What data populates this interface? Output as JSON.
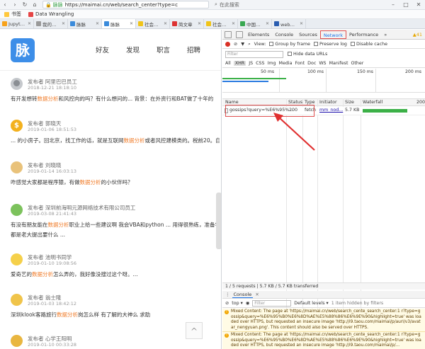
{
  "browser": {
    "site_name": "脉脉",
    "url": "https://maimai.cn/web/search_center?type=c",
    "search_placeholder": "在此搜索",
    "bookmarks": [
      "书签",
      "Data Wrangling"
    ],
    "tabs": [
      {
        "label": "Jupyter Lab",
        "active": false
      },
      {
        "label": "我的项目 - Kr",
        "active": false
      },
      {
        "label": "脉脉",
        "active": false
      },
      {
        "label": "脉脉",
        "active": true
      },
      {
        "label": "社会化聊天",
        "active": false
      },
      {
        "label": "简文章",
        "active": false
      },
      {
        "label": "社会化聊你",
        "active": false
      },
      {
        "label": "中国大学MO",
        "active": false
      },
      {
        "label": "web前端开",
        "active": false
      }
    ]
  },
  "page": {
    "logo_text": "脉",
    "nav": [
      "好友",
      "发现",
      "职言",
      "招聘"
    ],
    "posts": [
      {
        "author": "发布者 阿里巴巴员工",
        "time": "2018-12-21 18:18:10",
        "text_before": "有开发想转",
        "highlight": "数据分析",
        "text_after": "和风控向的吗？有什么想问的... 背景：在外资行和BAT做了十年的"
      },
      {
        "author": "发布者 郭晓天",
        "time": "2019-01-06 18:51:53",
        "text_before": "... 的小房子。回北京，找工作的话，就是互联网",
        "highlight": "数据分析",
        "text_after": "或者风控建模类的。税前20。自"
      },
      {
        "author": "发布者 刘晓晓",
        "time": "2019-01-14 16:03:13",
        "text_before": "咋感觉大家都是程序猿，有做",
        "highlight": "数据分析",
        "text_after": "的小伙伴吗？"
      },
      {
        "author": "发布者 深圳前海明元源网络技术有限公司员工",
        "time": "2019-03-08 21:41:43",
        "text_before": "有没有朋友能在",
        "highlight": "数据分析",
        "text_after": "职业上给一些建议啊 我会VBA和python ... 用得很熟练，准备学"
      },
      {
        "author": "",
        "time": "",
        "text_before": "都是老大提出要什么 ...",
        "highlight": "",
        "text_after": ""
      },
      {
        "author": "发布者 池明书同学",
        "time": "2019-01-10 19:08:56",
        "text_before": "爱奇艺的",
        "highlight": "数据分析",
        "text_after": "怎么弄的，我好像没搜过这个呀。..."
      },
      {
        "author": "发布者 翁士隆",
        "time": "2019-01-03 18:42:12",
        "text_before": "深圳klook客路旅行",
        "highlight": "数据分析",
        "text_after": "岗怎么样 有了解的大神么 求助"
      },
      {
        "author": "发布者 心学王阳明",
        "time": "2019-01-10 00:33:28",
        "text_before": "",
        "highlight": "",
        "text_after": ""
      }
    ],
    "back_to_top": "^"
  },
  "devtools": {
    "tabs": [
      "Elements",
      "Console",
      "Sources",
      "Network",
      "Performance",
      "»"
    ],
    "selected_tab": "Network",
    "warning_count": "▲41",
    "view_label": "View:",
    "group_by_frame": "Group by frame",
    "preserve_log": "Preserve log",
    "disable_cache": "Disable cache",
    "filter_placeholder": "Filter",
    "hide_data_urls": "Hide data URLs",
    "types": [
      "All",
      "XHR",
      "JS",
      "CSS",
      "Img",
      "Media",
      "Font",
      "Doc",
      "WS",
      "Manifest",
      "Other"
    ],
    "selected_type": "XHR",
    "timeline_ticks": [
      "50 ms",
      "100 ms",
      "150 ms",
      "200 ms"
    ],
    "columns": [
      "Name",
      "Status",
      "Type",
      "Initiator",
      "Size",
      "Waterfall"
    ],
    "waterfall_end": "200",
    "request": {
      "name": "gossips?query=%E6%95%...",
      "status": "200",
      "type": "fetch",
      "initiator": "mm_nod...",
      "size": "5.7 KB"
    },
    "status_text": "1 / 5 requests  |  5.7 KB / 5.7 KB transferred",
    "console": {
      "tab_label": "Console",
      "context": "top",
      "filter_placeholder": "Filter",
      "levels": "Default levels ▾",
      "hidden": "1 item hidden by filters",
      "messages": [
        {
          "text": "Mixed Content: The page at 'https://maimai.cn/web/search_cente_search_center:1 r?type=gossip&query=%E6%95%B0%E6%8D%AE%E5%88%86%E6%9E%90&highlight=true' was loaded over HTTPS, but requested an insecure image 'http://i9.taou.com/maimai/p/aurl/v3/avatar_nengyuan.png'. This content should also be served over HTTPS."
        },
        {
          "text": "Mixed Content: The page at 'https://maimai.cn/web/search_cente_search_center:1 r?type=gossip&query=%E6%95%B0%E6%8D%AE%E5%88%86%E6%9E%90&highlight=true' was loaded over HTTPS, but requested an insecure image 'http://i9.taou.com/maimai/p/..."
        }
      ]
    }
  }
}
